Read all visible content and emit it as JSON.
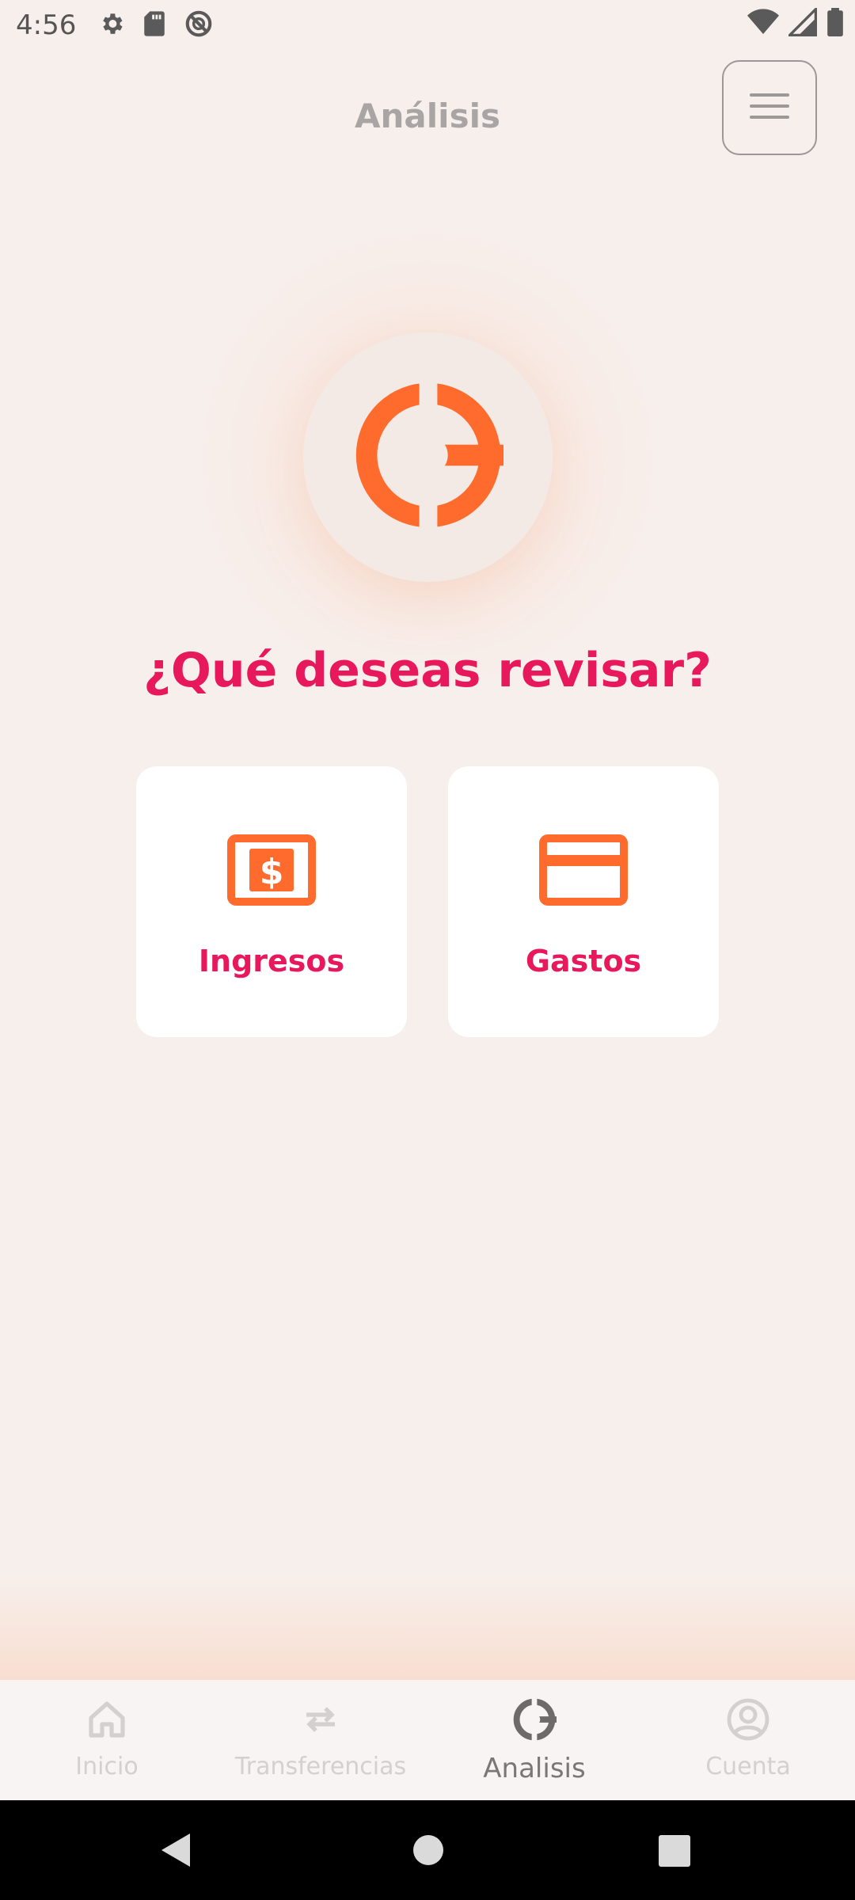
{
  "status_bar": {
    "time": "4:56",
    "left_icons": [
      "gear-icon",
      "sd-card-icon",
      "no-sync-icon"
    ],
    "right_icons": [
      "wifi-icon",
      "signal-icon",
      "battery-icon"
    ]
  },
  "header": {
    "title": "Análisis",
    "menu_icon": "hamburger-icon"
  },
  "hero": {
    "icon": "analysis-logo-icon",
    "question": "¿Qué deseas revisar?"
  },
  "options": [
    {
      "label": "Ingresos",
      "icon": "money-icon"
    },
    {
      "label": "Gastos",
      "icon": "credit-card-icon"
    }
  ],
  "bottom_nav": [
    {
      "label": "Inicio",
      "icon": "home-icon",
      "active": false
    },
    {
      "label": "Transferencias",
      "icon": "transfer-icon",
      "active": false
    },
    {
      "label": "Analisis",
      "icon": "analysis-icon",
      "active": true
    },
    {
      "label": "Cuenta",
      "icon": "account-icon",
      "active": false
    }
  ],
  "colors": {
    "background": "#F7EFEC",
    "accent_orange": "#FF6B2C",
    "accent_pink": "#E8185C",
    "title_gray": "#A9A5A4"
  }
}
